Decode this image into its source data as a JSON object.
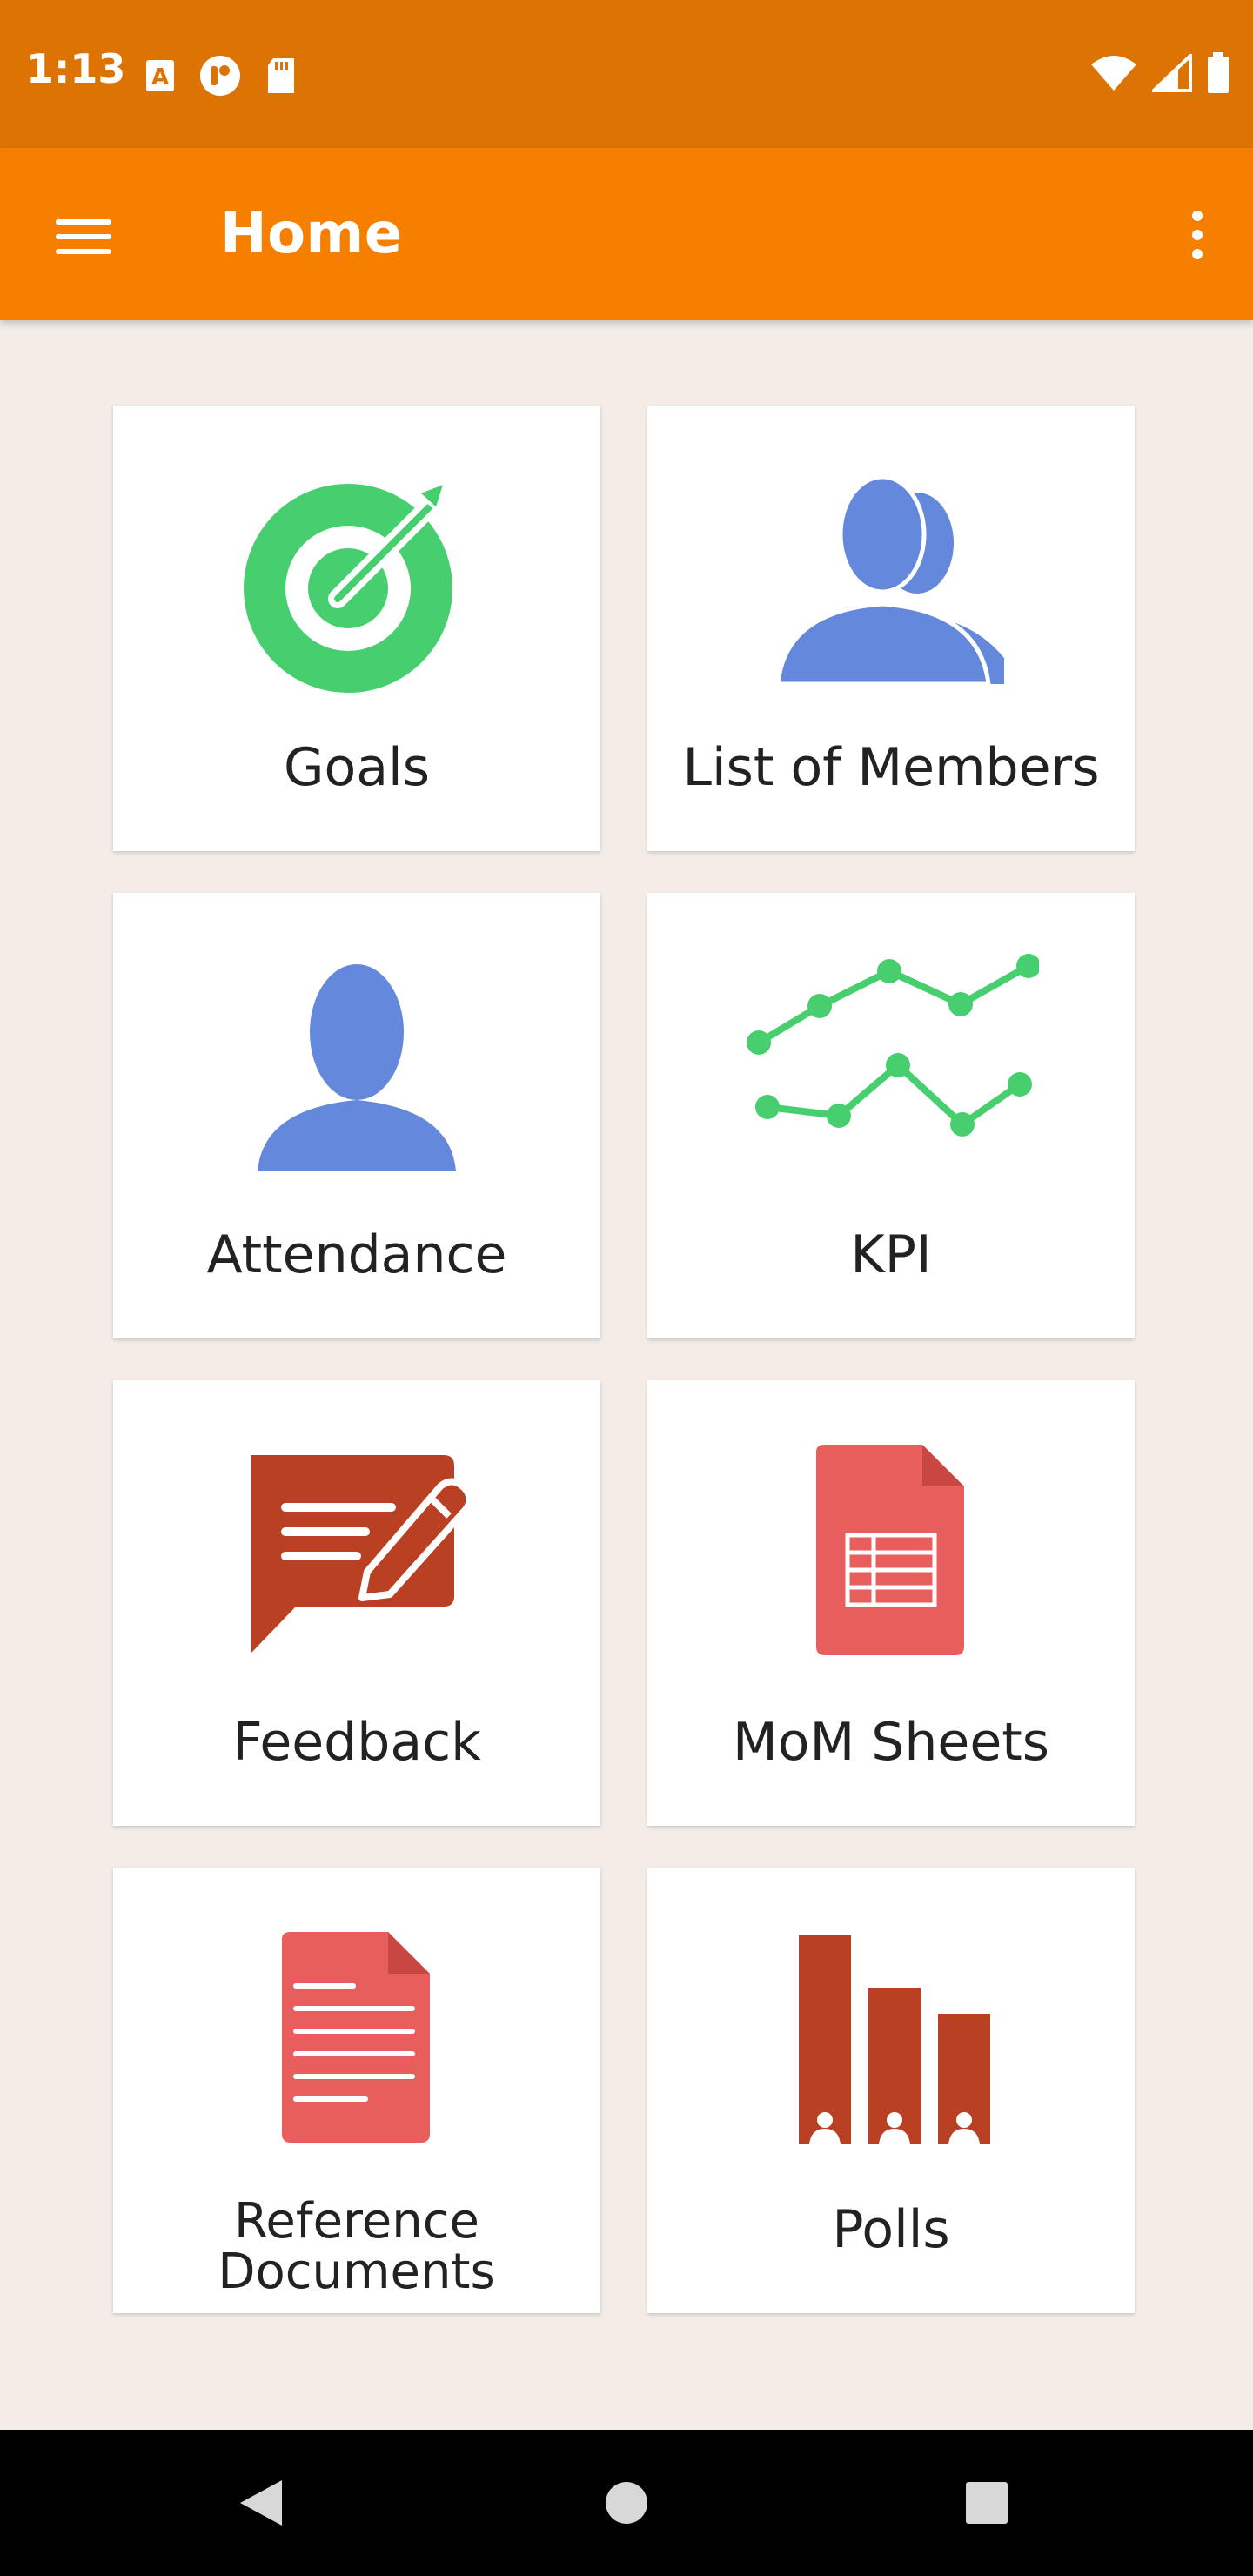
{
  "status_bar": {
    "time": "1:13",
    "left_icons": [
      "a-notification-icon",
      "app-notification-icon",
      "sd-card-icon"
    ],
    "right_icons": [
      "wifi-icon",
      "cell-signal-icon",
      "battery-icon"
    ]
  },
  "app_bar": {
    "title": "Home",
    "menu_icon": "hamburger-menu-icon",
    "overflow_icon": "more-vert-icon",
    "color": "#F77F00"
  },
  "tiles": [
    {
      "label": "Goals",
      "icon": "target-icon",
      "color": "#47CF6F"
    },
    {
      "label": "List of Members",
      "icon": "members-group-icon",
      "color": "#6488DB"
    },
    {
      "label": "Attendance",
      "icon": "person-icon",
      "color": "#6488DB"
    },
    {
      "label": "KPI",
      "icon": "line-chart-icon",
      "color": "#47CF6F"
    },
    {
      "label": "Feedback",
      "icon": "feedback-icon",
      "color": "#B94022"
    },
    {
      "label": "MoM Sheets",
      "icon": "spreadsheet-icon",
      "color": "#E85E5C"
    },
    {
      "label_line1": "Reference",
      "label_line2": "Documents",
      "icon": "document-icon",
      "color": "#E85E5C"
    },
    {
      "label": "Polls",
      "icon": "bar-chart-icon",
      "color": "#B94022"
    }
  ],
  "nav_bar": {
    "icons": [
      "back-icon",
      "home-icon",
      "recents-icon"
    ]
  },
  "colors": {
    "status_bar": "#DD7302",
    "background": "#F3ECE7"
  }
}
